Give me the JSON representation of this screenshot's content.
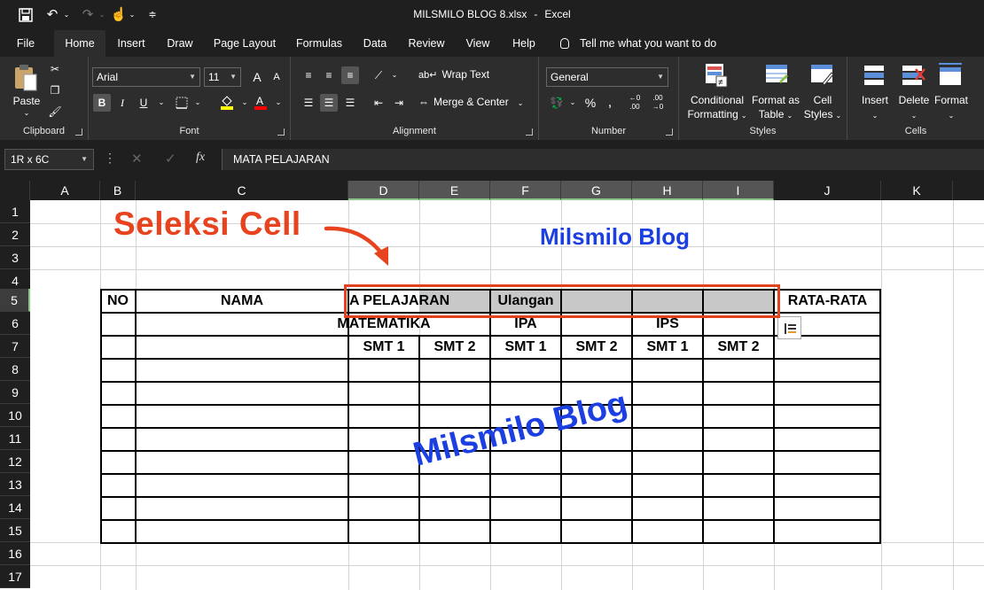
{
  "title_bar": {
    "save_icon": "save-icon",
    "undo_icon": "undo-icon",
    "redo_icon": "redo-icon",
    "touch_icon": "touch-mode-icon",
    "customize_icon": "customize-quick-access-icon",
    "file_name": "MILSMILO BLOG 8.xlsx",
    "separator": "-",
    "app_name": "Excel"
  },
  "menu": {
    "tabs": [
      "File",
      "Home",
      "Insert",
      "Draw",
      "Page Layout",
      "Formulas",
      "Data",
      "Review",
      "View",
      "Help"
    ],
    "active_tab": "Home",
    "tell_me": "Tell me what you want to do"
  },
  "ribbon": {
    "clipboard": {
      "label": "Clipboard",
      "paste": "Paste"
    },
    "font": {
      "label": "Font",
      "font_name": "Arial",
      "font_size": "11",
      "bold": "B",
      "italic": "I",
      "underline": "U",
      "grow": "A",
      "shrink": "A"
    },
    "alignment": {
      "label": "Alignment",
      "wrap_text": "Wrap Text",
      "merge_center": "Merge & Center"
    },
    "number": {
      "label": "Number",
      "format": "General",
      "percent": "%",
      "comma": ","
    },
    "styles": {
      "label": "Styles",
      "conditional": "Conditional",
      "conditional2": "Formatting",
      "format_as": "Format as",
      "format_as2": "Table",
      "cell": "Cell",
      "cell2": "Styles"
    },
    "cells": {
      "label": "Cells",
      "insert": "Insert",
      "delete": "Delete",
      "format": "Format"
    }
  },
  "formula_bar": {
    "name_box": "1R x 6C",
    "fx": "fx",
    "content": "MATA PELAJARAN"
  },
  "sheet": {
    "columns": [
      "A",
      "B",
      "C",
      "D",
      "E",
      "F",
      "G",
      "H",
      "I",
      "J",
      "K"
    ],
    "rows": [
      "1",
      "2",
      "3",
      "4",
      "5",
      "6",
      "7",
      "8",
      "9",
      "10",
      "11",
      "12",
      "13",
      "14",
      "15",
      "16",
      "17"
    ],
    "cells": {
      "no": "NO",
      "nama": "NAMA",
      "mata_pelajaran": "A PELAJARAN",
      "ulangan": "Ulangan",
      "rata_rata": "RATA-RATA",
      "matematika": "MATEMATIKA",
      "ipa": "IPA",
      "ips": "IPS",
      "smt": [
        "SMT 1",
        "SMT 2",
        "SMT 1",
        "SMT 2",
        "SMT 1",
        "SMT 2"
      ]
    },
    "selected_columns": [
      "D",
      "E",
      "F",
      "G",
      "H",
      "I"
    ],
    "selected_row": "5"
  },
  "annotations": {
    "callout": "Seleksi Cell",
    "watermark_top": "Milsmilo Blog",
    "watermark_center": "Milsmilo Blog",
    "highlight_color": "#e2421d",
    "watermark_color": "#1b3fe0"
  }
}
